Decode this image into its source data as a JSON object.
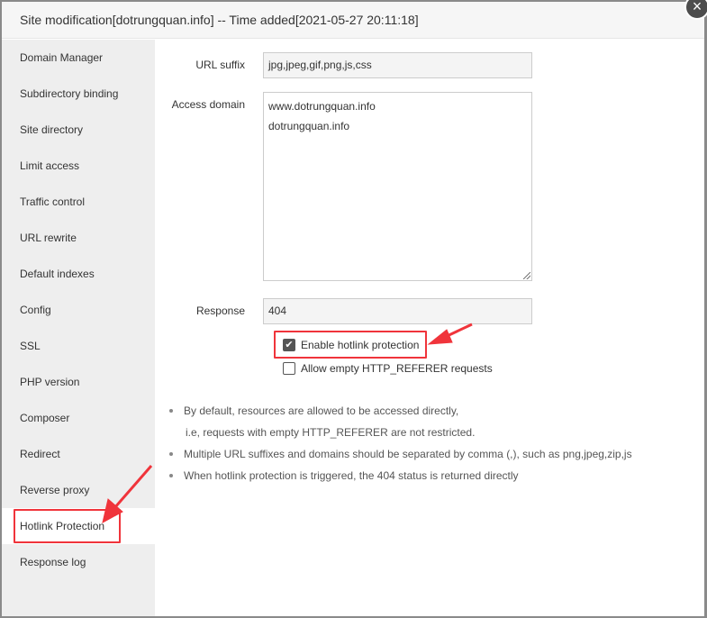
{
  "dialog": {
    "title": "Site modification[dotrungquan.info] -- Time added[2021-05-27 20:11:18]",
    "close_icon": "×"
  },
  "sidebar": {
    "items": [
      {
        "label": "Domain Manager"
      },
      {
        "label": "Subdirectory binding"
      },
      {
        "label": "Site directory"
      },
      {
        "label": "Limit access"
      },
      {
        "label": "Traffic control"
      },
      {
        "label": "URL rewrite"
      },
      {
        "label": "Default indexes"
      },
      {
        "label": "Config"
      },
      {
        "label": "SSL"
      },
      {
        "label": "PHP version"
      },
      {
        "label": "Composer"
      },
      {
        "label": "Redirect"
      },
      {
        "label": "Reverse proxy"
      },
      {
        "label": "Hotlink Protection",
        "active": true
      },
      {
        "label": "Response log"
      }
    ]
  },
  "form": {
    "url_suffix": {
      "label": "URL suffix",
      "value": "jpg,jpeg,gif,png,js,css"
    },
    "access_domain": {
      "label": "Access domain",
      "lines": [
        "www.dotrungquan.info",
        "dotrungquan.info"
      ]
    },
    "response": {
      "label": "Response",
      "value": "404"
    },
    "enable_hotlink": {
      "label": "Enable hotlink protection",
      "checked": true
    },
    "allow_empty_referer": {
      "label": "Allow empty HTTP_REFERER requests",
      "checked": false
    }
  },
  "tips": {
    "item1": "By default, resources are allowed to be accessed directly,",
    "item1_cont": "i.e, requests with empty HTTP_REFERER are not restricted.",
    "item2": "Multiple URL suffixes and domains should be separated by comma (,), such as png,jpeg,zip,js",
    "item3": "When hotlink protection is triggered, the 404 status is returned directly"
  },
  "annotation_color": "#f0343b"
}
